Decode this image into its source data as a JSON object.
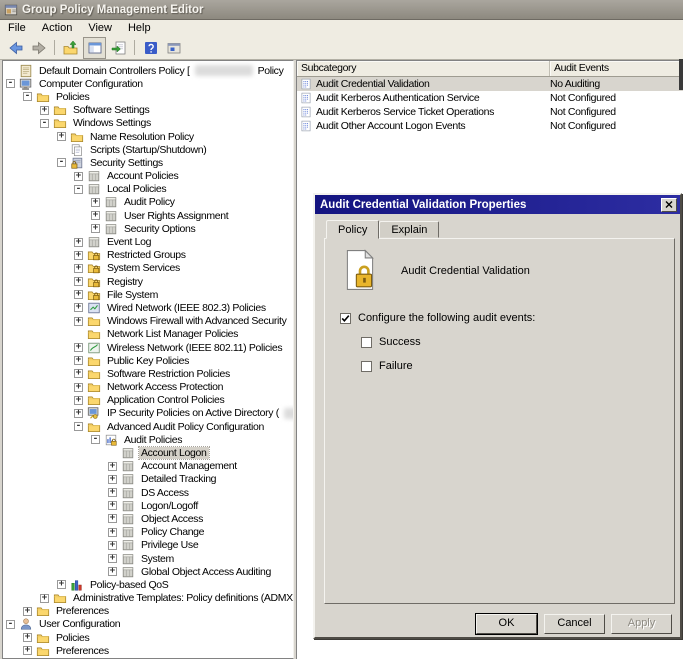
{
  "window": {
    "title": "Group Policy Management Editor"
  },
  "menu": {
    "items": [
      "File",
      "Action",
      "View",
      "Help"
    ]
  },
  "toolbar": {
    "icons": [
      "back",
      "forward",
      "sep",
      "up-one-level",
      "show-console-tree",
      "export-list",
      "sep",
      "help",
      "new-window"
    ]
  },
  "tree": {
    "items": [
      {
        "label": "Default Domain Controllers Policy [",
        "level": 0,
        "exp": "",
        "icon": "gpo",
        "blur": 58,
        "suffix": "Policy"
      },
      {
        "label": "Computer Configuration",
        "level": 0,
        "exp": "-",
        "icon": "computer"
      },
      {
        "label": "Policies",
        "level": 1,
        "exp": "-",
        "icon": "folder"
      },
      {
        "label": "Software Settings",
        "level": 2,
        "exp": "+",
        "icon": "folder"
      },
      {
        "label": "Windows Settings",
        "level": 2,
        "exp": "-",
        "icon": "folder"
      },
      {
        "label": "Name Resolution Policy",
        "level": 3,
        "exp": "+",
        "icon": "folder"
      },
      {
        "label": "Scripts (Startup/Shutdown)",
        "level": 3,
        "exp": "",
        "icon": "pages"
      },
      {
        "label": "Security Settings",
        "level": 3,
        "exp": "-",
        "icon": "box-lock"
      },
      {
        "label": "Account Policies",
        "level": 4,
        "exp": "+",
        "icon": "ledger"
      },
      {
        "label": "Local Policies",
        "level": 4,
        "exp": "-",
        "icon": "ledger"
      },
      {
        "label": "Audit Policy",
        "level": 5,
        "exp": "+",
        "icon": "ledger"
      },
      {
        "label": "User Rights Assignment",
        "level": 5,
        "exp": "+",
        "icon": "ledger"
      },
      {
        "label": "Security Options",
        "level": 5,
        "exp": "+",
        "icon": "ledger"
      },
      {
        "label": "Event Log",
        "level": 4,
        "exp": "+",
        "icon": "ledger"
      },
      {
        "label": "Restricted Groups",
        "level": 4,
        "exp": "+",
        "icon": "folder-lock"
      },
      {
        "label": "System Services",
        "level": 4,
        "exp": "+",
        "icon": "folder-lock"
      },
      {
        "label": "Registry",
        "level": 4,
        "exp": "+",
        "icon": "folder-lock"
      },
      {
        "label": "File System",
        "level": 4,
        "exp": "+",
        "icon": "folder-lock"
      },
      {
        "label": "Wired Network (IEEE 802.3) Policies",
        "level": 4,
        "exp": "+",
        "icon": "wired"
      },
      {
        "label": "Windows Firewall with Advanced Security",
        "level": 4,
        "exp": "+",
        "icon": "folder"
      },
      {
        "label": "Network List Manager Policies",
        "level": 4,
        "exp": "",
        "icon": "folder"
      },
      {
        "label": "Wireless Network (IEEE 802.11) Policies",
        "level": 4,
        "exp": "+",
        "icon": "wireless"
      },
      {
        "label": "Public Key Policies",
        "level": 4,
        "exp": "+",
        "icon": "folder"
      },
      {
        "label": "Software Restriction Policies",
        "level": 4,
        "exp": "+",
        "icon": "folder"
      },
      {
        "label": "Network Access Protection",
        "level": 4,
        "exp": "+",
        "icon": "folder"
      },
      {
        "label": "Application Control Policies",
        "level": 4,
        "exp": "+",
        "icon": "folder"
      },
      {
        "label": "IP Security Policies on Active Directory (",
        "level": 4,
        "exp": "+",
        "icon": "ipsec",
        "blur": 48
      },
      {
        "label": "Advanced Audit Policy Configuration",
        "level": 4,
        "exp": "-",
        "icon": "folder"
      },
      {
        "label": "Audit Policies",
        "level": 5,
        "exp": "-",
        "icon": "auditpol"
      },
      {
        "label": "Account Logon",
        "level": 6,
        "exp": "",
        "icon": "ledger",
        "selected": true
      },
      {
        "label": "Account Management",
        "level": 6,
        "exp": "+",
        "icon": "ledger"
      },
      {
        "label": "Detailed Tracking",
        "level": 6,
        "exp": "+",
        "icon": "ledger"
      },
      {
        "label": "DS Access",
        "level": 6,
        "exp": "+",
        "icon": "ledger"
      },
      {
        "label": "Logon/Logoff",
        "level": 6,
        "exp": "+",
        "icon": "ledger"
      },
      {
        "label": "Object Access",
        "level": 6,
        "exp": "+",
        "icon": "ledger"
      },
      {
        "label": "Policy Change",
        "level": 6,
        "exp": "+",
        "icon": "ledger"
      },
      {
        "label": "Privilege Use",
        "level": 6,
        "exp": "+",
        "icon": "ledger"
      },
      {
        "label": "System",
        "level": 6,
        "exp": "+",
        "icon": "ledger"
      },
      {
        "label": "Global Object Access Auditing",
        "level": 6,
        "exp": "+",
        "icon": "ledger"
      },
      {
        "label": "Policy-based QoS",
        "level": 3,
        "exp": "+",
        "icon": "qos"
      },
      {
        "label": "Administrative Templates: Policy definitions (ADMX files)",
        "level": 2,
        "exp": "+",
        "icon": "folder"
      },
      {
        "label": "Preferences",
        "level": 1,
        "exp": "+",
        "icon": "folder"
      },
      {
        "label": "User Configuration",
        "level": 0,
        "exp": "-",
        "icon": "user"
      },
      {
        "label": "Policies",
        "level": 1,
        "exp": "+",
        "icon": "folder"
      },
      {
        "label": "Preferences",
        "level": 1,
        "exp": "+",
        "icon": "folder"
      }
    ]
  },
  "list": {
    "columns": [
      "Subcategory",
      "Audit Events"
    ],
    "rows": [
      {
        "label": "Audit Credential Validation",
        "value": "No Auditing",
        "selected": true
      },
      {
        "label": "Audit Kerberos Authentication Service",
        "value": "Not Configured"
      },
      {
        "label": "Audit Kerberos Service Ticket Operations",
        "value": "Not Configured"
      },
      {
        "label": "Audit Other Account Logon Events",
        "value": "Not Configured"
      }
    ]
  },
  "dialog": {
    "title": "Audit Credential Validation Properties",
    "tabs": [
      "Policy",
      "Explain"
    ],
    "policy_name": "Audit Credential Validation",
    "configure_label": "Configure the following audit events:",
    "configure_checked": true,
    "success_label": "Success",
    "success_checked": false,
    "failure_label": "Failure",
    "failure_checked": false,
    "ok_label": "OK",
    "cancel_label": "Cancel",
    "apply_label": "Apply"
  },
  "colors": {
    "face": "#d8d5ce",
    "menubar": "#efece2",
    "titlebar_gray": "#8d897f",
    "dialog_titlebar_navy": "#141480",
    "selection_inactive": "#d4d0c8",
    "tree_background": "#ffffff"
  }
}
